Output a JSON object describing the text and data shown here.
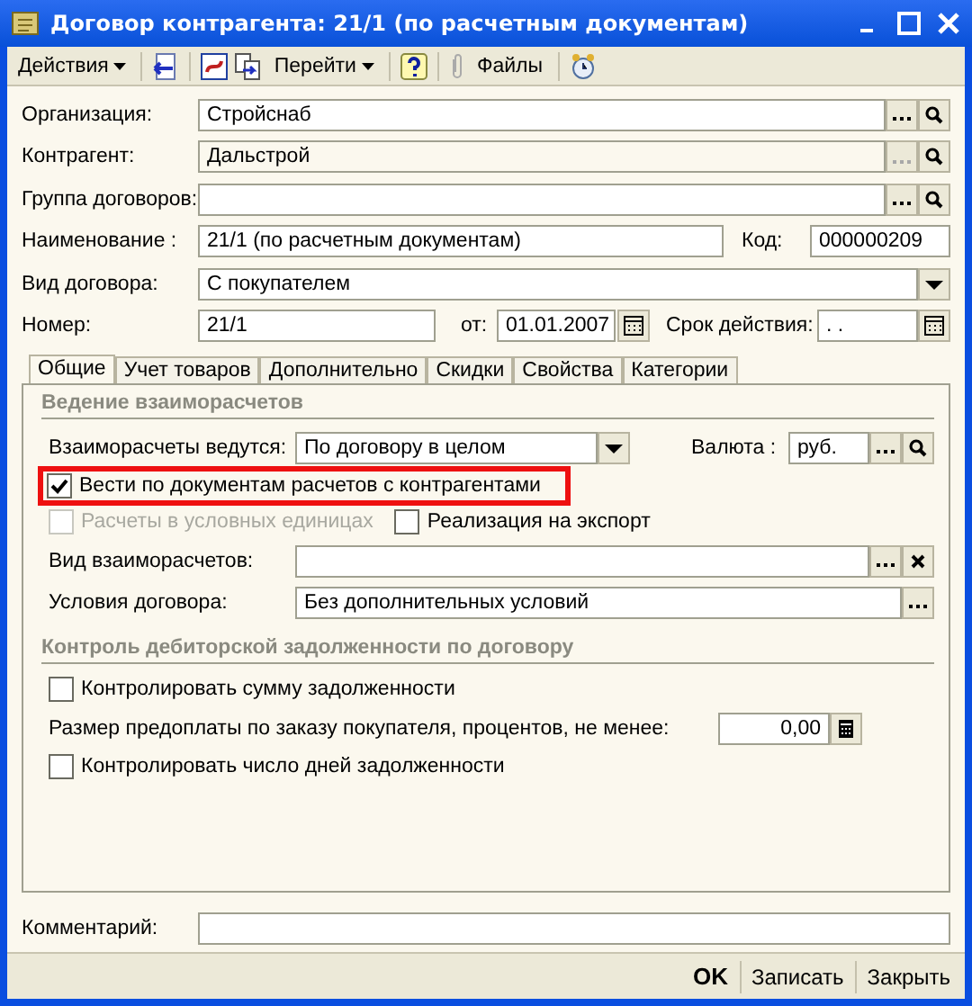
{
  "window": {
    "title": "Договор контрагента: 21/1 (по расчетным документам)"
  },
  "toolbar": {
    "actions": "Действия",
    "goto": "Перейти",
    "files": "Файлы"
  },
  "header": {
    "organization": {
      "label": "Организация:",
      "value": "Стройснаб",
      "readonly": false
    },
    "counterparty": {
      "label": "Контрагент:",
      "value": "Дальстрой",
      "readonly": true
    },
    "contract_group": {
      "label": "Группа договоров:",
      "readonly": false
    },
    "name": {
      "label": "Наименование :",
      "value": "21/1 (по расчетным документам)"
    },
    "code": {
      "label": "Код:",
      "value": "000000209"
    },
    "contract_type": {
      "label": "Вид договора:",
      "value": "С покупателем"
    },
    "number": {
      "label": "Номер:",
      "value": "21/1"
    },
    "date": {
      "label": "от:",
      "value": "01.01.2007"
    },
    "validity": {
      "label": "Срок действия:",
      "value": ". ."
    }
  },
  "tabs": [
    {
      "label": "Общие",
      "selected": true
    },
    {
      "label": "Учет товаров",
      "selected": false
    },
    {
      "label": "Дополнительно",
      "selected": false
    },
    {
      "label": "Скидки",
      "selected": false
    },
    {
      "label": "Свойства",
      "selected": false
    },
    {
      "label": "Категории",
      "selected": false
    }
  ],
  "settlements": {
    "title": "Ведение взаиморасчетов",
    "mode": {
      "label": "Взаиморасчеты ведутся:",
      "value": "По договору в целом"
    },
    "currency": {
      "label": "Валюта :",
      "value": "руб."
    },
    "by_documents": {
      "label": "Вести по документам расчетов с контрагентами",
      "checked": true,
      "disabled": false,
      "highlighted": true
    },
    "conventional_units": {
      "label": "Расчеты в условных единицах",
      "checked": false,
      "disabled": true
    },
    "export": {
      "label": "Реализация на экспорт",
      "checked": false,
      "disabled": false
    },
    "kind": {
      "label": "Вид взаиморасчетов:"
    },
    "terms": {
      "label": "Условия договора:",
      "value": "Без дополнительных условий"
    }
  },
  "receivables": {
    "title": "Контроль дебиторской задолженности по договору",
    "control_sum": {
      "label": "Контролировать сумму задолженности",
      "checked": false,
      "disabled": false
    },
    "prepayment": {
      "label": "Размер предоплаты по заказу покупателя, процентов, не менее:",
      "value": "0,00"
    },
    "control_days": {
      "label": "Контролировать число дней задолженности",
      "checked": false,
      "disabled": false
    }
  },
  "comment": {
    "label": "Комментарий:"
  },
  "buttons": [
    {
      "label": "OK",
      "kind": "default"
    },
    {
      "label": "Записать",
      "kind": "normal"
    },
    {
      "label": "Закрыть",
      "kind": "normal"
    }
  ]
}
